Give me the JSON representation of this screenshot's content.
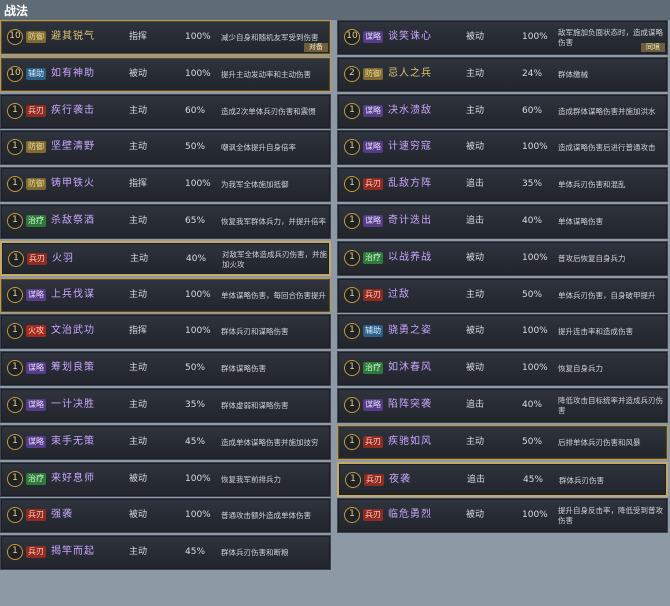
{
  "header": {
    "title": "战法"
  },
  "left": [
    {
      "level": "10",
      "type": "防御",
      "type_cls": "t-fangyu",
      "name": "避其锐气",
      "name_cls": "n-gold",
      "cat": "指挥",
      "rate": "100%",
      "desc": "减少自身和随机友军受到伤害",
      "tag": "对备",
      "frame": "gold"
    },
    {
      "level": "10",
      "type": "辅助",
      "type_cls": "t-fuzhu",
      "name": "如有神助",
      "name_cls": "n-purple",
      "cat": "被动",
      "rate": "100%",
      "desc": "提升主动发动率和主动伤害",
      "tag": "",
      "frame": "gold"
    },
    {
      "level": "1",
      "type": "兵刃",
      "type_cls": "t-bingren",
      "name": "疾行袭击",
      "name_cls": "n-purple",
      "cat": "主动",
      "rate": "60%",
      "desc": "造成2次单体兵刃伤害和震慑",
      "tag": "",
      "frame": ""
    },
    {
      "level": "1",
      "type": "防御",
      "type_cls": "t-fangyu",
      "name": "坚壁清野",
      "name_cls": "n-purple",
      "cat": "主动",
      "rate": "50%",
      "desc": "嘲讽全体提升自身倍率",
      "tag": "",
      "frame": ""
    },
    {
      "level": "1",
      "type": "防御",
      "type_cls": "t-fangyu",
      "name": "铸甲铁火",
      "name_cls": "n-purple",
      "cat": "指挥",
      "rate": "100%",
      "desc": "为我军全体施加抵御",
      "tag": "",
      "frame": ""
    },
    {
      "level": "1",
      "type": "治疗",
      "type_cls": "t-zhiliao",
      "name": "杀敌祭酒",
      "name_cls": "n-purple",
      "cat": "主动",
      "rate": "65%",
      "desc": "恢复我军群体兵力，并提升倍率",
      "tag": "",
      "frame": ""
    },
    {
      "level": "1",
      "type": "兵刃",
      "type_cls": "t-bingren",
      "name": "火羽",
      "name_cls": "n-purple",
      "cat": "主动",
      "rate": "40%",
      "desc": "对敌军全体造成兵刃伤害，并施加火攻",
      "tag": "",
      "frame": "gold-strong"
    },
    {
      "level": "1",
      "type": "谋略",
      "type_cls": "t-moulue",
      "name": "上兵伐谋",
      "name_cls": "n-purple",
      "cat": "主动",
      "rate": "100%",
      "desc": "单体谋略伤害，每回合伤害提升",
      "tag": "",
      "frame": "gold"
    },
    {
      "level": "1",
      "type": "火攻",
      "type_cls": "t-huogong",
      "name": "文治武功",
      "name_cls": "n-purple",
      "cat": "指挥",
      "rate": "100%",
      "desc": "群体兵刃和谋略伤害",
      "tag": "",
      "frame": ""
    },
    {
      "level": "1",
      "type": "谋略",
      "type_cls": "t-moulue",
      "name": "筹划良策",
      "name_cls": "n-purple",
      "cat": "主动",
      "rate": "50%",
      "desc": "群体谋略伤害",
      "tag": "",
      "frame": ""
    },
    {
      "level": "1",
      "type": "谋略",
      "type_cls": "t-moulue",
      "name": "一计决胜",
      "name_cls": "n-purple",
      "cat": "主动",
      "rate": "35%",
      "desc": "群体虚弱和谋略伤害",
      "tag": "",
      "frame": ""
    },
    {
      "level": "1",
      "type": "谋略",
      "type_cls": "t-moulue",
      "name": "束手无策",
      "name_cls": "n-purple",
      "cat": "主动",
      "rate": "45%",
      "desc": "造成单体谋略伤害并施加技穷",
      "tag": "",
      "frame": ""
    },
    {
      "level": "1",
      "type": "治疗",
      "type_cls": "t-zhiliao",
      "name": "来好息师",
      "name_cls": "n-purple",
      "cat": "被动",
      "rate": "100%",
      "desc": "恢复我军前排兵力",
      "tag": "",
      "frame": ""
    },
    {
      "level": "1",
      "type": "兵刃",
      "type_cls": "t-bingren",
      "name": "强袭",
      "name_cls": "n-purple",
      "cat": "被动",
      "rate": "100%",
      "desc": "普通攻击额外造成单体伤害",
      "tag": "",
      "frame": ""
    },
    {
      "level": "1",
      "type": "兵刃",
      "type_cls": "t-bingren",
      "name": "揭竿而起",
      "name_cls": "n-purple",
      "cat": "主动",
      "rate": "45%",
      "desc": "群体兵刃伤害和断粮",
      "tag": "",
      "frame": ""
    }
  ],
  "right": [
    {
      "level": "10",
      "type": "谋略",
      "type_cls": "t-moulue",
      "name": "谈笑诛心",
      "name_cls": "n-purple",
      "cat": "被动",
      "rate": "100%",
      "desc": "敌军施加负面状态时，造成谋略伤害",
      "tag": "同境",
      "frame": ""
    },
    {
      "level": "2",
      "type": "防御",
      "type_cls": "t-fangyu",
      "name": "忌人之兵",
      "name_cls": "n-gold",
      "cat": "主动",
      "rate": "24%",
      "desc": "群体缴械",
      "tag": "",
      "frame": ""
    },
    {
      "level": "1",
      "type": "谋略",
      "type_cls": "t-moulue",
      "name": "决水溃敌",
      "name_cls": "n-purple",
      "cat": "主动",
      "rate": "60%",
      "desc": "造成群体谋略伤害并施加洪水",
      "tag": "",
      "frame": ""
    },
    {
      "level": "1",
      "type": "谋略",
      "type_cls": "t-moulue",
      "name": "计速穷寇",
      "name_cls": "n-purple",
      "cat": "被动",
      "rate": "100%",
      "desc": "造成谋略伤害后进行普通攻击",
      "tag": "",
      "frame": ""
    },
    {
      "level": "1",
      "type": "兵刃",
      "type_cls": "t-bingren",
      "name": "乱敌方阵",
      "name_cls": "n-purple",
      "cat": "追击",
      "rate": "35%",
      "desc": "单体兵刃伤害和混乱",
      "tag": "",
      "frame": ""
    },
    {
      "level": "1",
      "type": "谋略",
      "type_cls": "t-moulue",
      "name": "奇计迭出",
      "name_cls": "n-purple",
      "cat": "追击",
      "rate": "40%",
      "desc": "单体谋略伤害",
      "tag": "",
      "frame": ""
    },
    {
      "level": "1",
      "type": "治疗",
      "type_cls": "t-zhiliao",
      "name": "以战养战",
      "name_cls": "n-purple",
      "cat": "被动",
      "rate": "100%",
      "desc": "普攻后恢复自身兵力",
      "tag": "",
      "frame": ""
    },
    {
      "level": "1",
      "type": "兵刃",
      "type_cls": "t-bingren",
      "name": "过敌",
      "name_cls": "n-purple",
      "cat": "主动",
      "rate": "50%",
      "desc": "单体兵刃伤害，自身破甲提升",
      "tag": "",
      "frame": ""
    },
    {
      "level": "1",
      "type": "辅助",
      "type_cls": "t-fuzhu",
      "name": "骁勇之姿",
      "name_cls": "n-purple",
      "cat": "被动",
      "rate": "100%",
      "desc": "提升连击率和造成伤害",
      "tag": "",
      "frame": ""
    },
    {
      "level": "1",
      "type": "治疗",
      "type_cls": "t-zhiliao",
      "name": "如沐春风",
      "name_cls": "n-purple",
      "cat": "被动",
      "rate": "100%",
      "desc": "恢复自身兵力",
      "tag": "",
      "frame": ""
    },
    {
      "level": "1",
      "type": "谋略",
      "type_cls": "t-moulue",
      "name": "陷阵突袭",
      "name_cls": "n-purple",
      "cat": "追击",
      "rate": "40%",
      "desc": "降低攻击目标统率并造成兵刃伤害",
      "tag": "",
      "frame": ""
    },
    {
      "level": "1",
      "type": "兵刃",
      "type_cls": "t-bingren",
      "name": "疾驰如风",
      "name_cls": "n-purple",
      "cat": "主动",
      "rate": "50%",
      "desc": "后排单体兵刃伤害和风暴",
      "tag": "",
      "frame": "gold"
    },
    {
      "level": "1",
      "type": "兵刃",
      "type_cls": "t-bingren",
      "name": "夜袭",
      "name_cls": "n-purple",
      "cat": "追击",
      "rate": "45%",
      "desc": "群体兵刃伤害",
      "tag": "",
      "frame": "gold-strong"
    },
    {
      "level": "1",
      "type": "兵刃",
      "type_cls": "t-bingren",
      "name": "临危勇烈",
      "name_cls": "n-purple",
      "cat": "被动",
      "rate": "100%",
      "desc": "提升自身反击率，降低受到普攻伤害",
      "tag": "",
      "frame": ""
    }
  ]
}
